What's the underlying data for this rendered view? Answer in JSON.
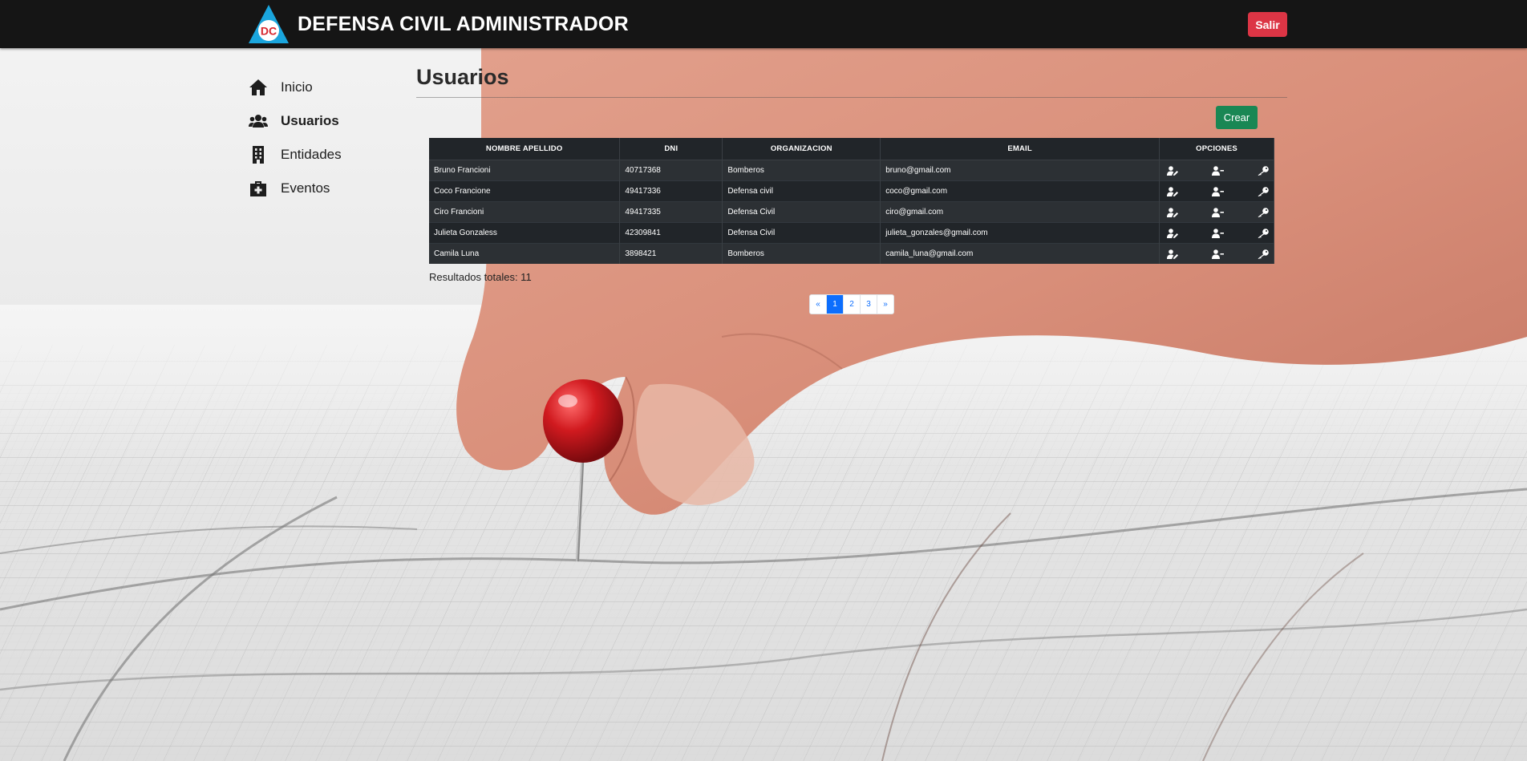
{
  "header": {
    "logo_text": "DC",
    "title": "DEFENSA CIVIL ADMINISTRADOR",
    "logout_label": "Salir"
  },
  "sidebar": {
    "items": [
      {
        "label": "Inicio",
        "icon": "home-icon",
        "active": false
      },
      {
        "label": "Usuarios",
        "icon": "users-icon",
        "active": true
      },
      {
        "label": "Entidades",
        "icon": "building-icon",
        "active": false
      },
      {
        "label": "Eventos",
        "icon": "medkit-icon",
        "active": false
      }
    ]
  },
  "main": {
    "title": "Usuarios",
    "create_label": "Crear",
    "table": {
      "headers": [
        "NOMBRE APELLIDO",
        "DNI",
        "ORGANIZACION",
        "EMAIL",
        "OPCIONES"
      ],
      "rows": [
        [
          "Bruno Francioni",
          "40717368",
          "Bomberos",
          "bruno@gmail.com"
        ],
        [
          "Coco Francione",
          "49417336",
          "Defensa civil",
          "coco@gmail.com"
        ],
        [
          "Ciro Francioni",
          "49417335",
          "Defensa Civil",
          "ciro@gmail.com"
        ],
        [
          "Julieta Gonzaless",
          "42309841",
          "Defensa Civil",
          "julieta_gonzales@gmail.com"
        ],
        [
          "Camila Luna",
          "3898421",
          "Bomberos",
          "camila_luna@gmail.com"
        ]
      ],
      "option_icons": [
        "user-edit-icon",
        "user-remove-icon",
        "key-icon"
      ]
    },
    "total_results": "Resultados totales: 11",
    "pagination": {
      "prev": "«",
      "pages": [
        "1",
        "2",
        "3"
      ],
      "active_page": "1",
      "next": "»"
    }
  },
  "colors": {
    "header_bg": "#151515",
    "logout": "#dc3545",
    "create": "#198754",
    "table_bg": "#212529",
    "page_active": "#0d6efd",
    "logo_blue": "#1aa5dd",
    "logo_red": "#d6262e"
  }
}
